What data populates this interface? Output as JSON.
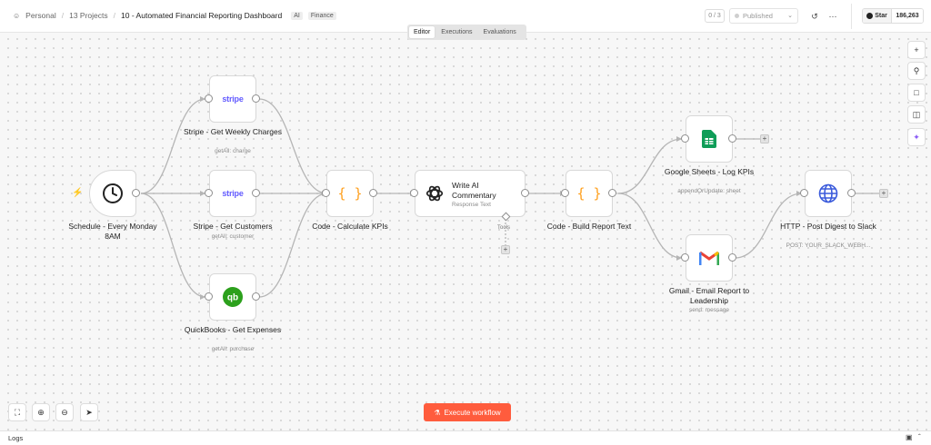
{
  "header": {
    "breadcrumb": {
      "personal": "Personal",
      "projects": "13 Projects",
      "title": "10 - Automated Financial Reporting Dashboard",
      "tags": [
        "AI",
        "Finance"
      ]
    },
    "counter": "0 / 3",
    "publish_label": "Published",
    "github": {
      "star_label": "Star",
      "star_count": "186,263"
    }
  },
  "tabs": [
    {
      "label": "Editor",
      "active": true
    },
    {
      "label": "Executions",
      "active": false
    },
    {
      "label": "Evaluations",
      "active": false
    }
  ],
  "nodes": {
    "schedule": {
      "label": "Schedule - Every Monday 8AM",
      "icon": "clock-icon"
    },
    "stripe_charges": {
      "logo": "stripe",
      "label": "Stripe - Get Weekly Charges",
      "sub": "getAll: charge"
    },
    "stripe_customers": {
      "logo": "stripe",
      "label": "Stripe - Get Customers",
      "sub": "getAll: customer"
    },
    "quickbooks": {
      "label": "QuickBooks - Get Expenses",
      "sub": "getAll: purchase",
      "icon": "quickbooks-icon"
    },
    "code_kpis": {
      "glyph": "{ }",
      "label": "Code - Calculate KPIs"
    },
    "ai_commentary": {
      "label": "Write AI Commentary",
      "sub": "Response Text",
      "tools_label": "Tools",
      "icon": "openai-icon"
    },
    "code_report": {
      "glyph": "{ }",
      "label": "Code - Build Report Text"
    },
    "sheets": {
      "label": "Google Sheets - Log KPIs",
      "sub": "appendOrUpdate: sheet",
      "icon": "google-sheets-icon"
    },
    "gmail": {
      "label": "Gmail - Email Report to Leadership",
      "sub": "send: message",
      "icon": "gmail-icon"
    },
    "http": {
      "label": "HTTP - Post Digest to Slack",
      "sub": "POST: YOUR_SLACK_WEBH...",
      "icon": "globe-icon"
    }
  },
  "execute_label": "Execute workflow",
  "logs_label": "Logs",
  "colors": {
    "accent": "#ff5c3d",
    "stripe": "#635bff",
    "code": "#ff9f1c",
    "sheets": "#0f9d58",
    "quickbooks": "#2ca01c",
    "http": "#3b5bdb"
  }
}
